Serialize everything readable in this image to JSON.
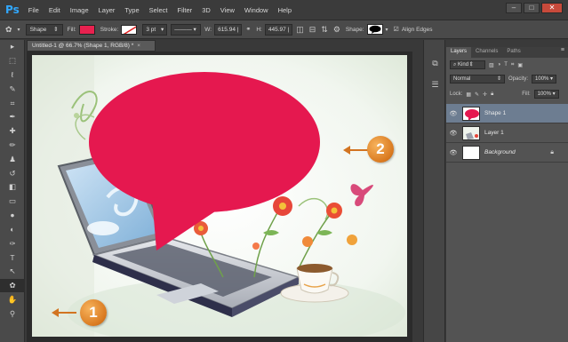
{
  "app": {
    "logo": "Ps",
    "menu": [
      "File",
      "Edit",
      "Image",
      "Layer",
      "Type",
      "Select",
      "Filter",
      "3D",
      "View",
      "Window",
      "Help"
    ],
    "window_buttons": {
      "minimize": "–",
      "maximize": "□",
      "close": "✕"
    }
  },
  "options_bar": {
    "tool_icon": "custom-shape-tool-icon",
    "mode": "Shape",
    "fill_label": "Fill:",
    "fill_color": "#e8214f",
    "stroke_label": "Stroke:",
    "stroke_width": "3 pt",
    "w_label": "W:",
    "w_value": "615.94 |",
    "h_label": "H:",
    "h_value": "445.97 |",
    "shape_label": "Shape:",
    "align_edges": "Align Edges"
  },
  "document": {
    "tab_title": "Untitled-1 @ 66.7% (Shape 1, RGB/8) *",
    "tab_close": "×",
    "speech_bubble_color": "#e5184f"
  },
  "tools": [
    "move-tool-icon",
    "marquee-tool-icon",
    "lasso-tool-icon",
    "quick-select-tool-icon",
    "crop-tool-icon",
    "eyedropper-tool-icon",
    "healing-brush-tool-icon",
    "brush-tool-icon",
    "clone-stamp-tool-icon",
    "history-brush-tool-icon",
    "eraser-tool-icon",
    "gradient-tool-icon",
    "blur-tool-icon",
    "dodge-tool-icon",
    "pen-tool-icon",
    "type-tool-icon",
    "path-select-tool-icon",
    "custom-shape-tool-icon",
    "hand-tool-icon",
    "zoom-tool-icon"
  ],
  "tool_glyphs": [
    "▸",
    "⬚",
    "ℓ",
    "✎",
    "⌗",
    "✒",
    "✚",
    "✏",
    "♟",
    "↺",
    "◧",
    "▭",
    "●",
    "◐",
    "✑",
    "T",
    "↖",
    "✿",
    "✋",
    "⚲"
  ],
  "layers_panel": {
    "tabs": [
      "Layers",
      "Channels",
      "Paths"
    ],
    "filter_label": "Kind",
    "blend_mode": "Normal",
    "opacity_label": "Opacity:",
    "opacity_value": "100%",
    "lock_label": "Lock:",
    "fill_label": "Fill:",
    "fill_value": "100%",
    "layers": [
      {
        "name": "Shape 1",
        "selected": true
      },
      {
        "name": "Layer 1",
        "selected": false
      },
      {
        "name": "Background",
        "selected": false,
        "locked": true
      }
    ]
  },
  "callouts": [
    {
      "number": "1"
    },
    {
      "number": "2"
    }
  ]
}
